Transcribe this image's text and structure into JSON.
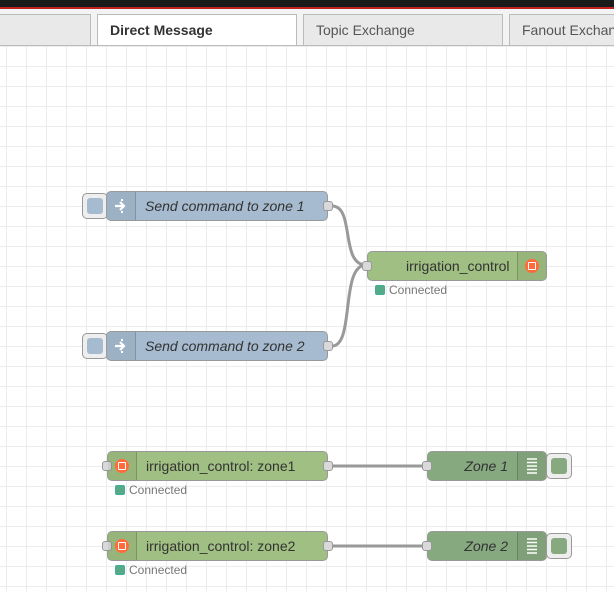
{
  "tabs": [
    {
      "label": ""
    },
    {
      "label": "Direct Message"
    },
    {
      "label": "Topic Exchange"
    },
    {
      "label": "Fanout Exchange"
    }
  ],
  "nodes": {
    "inject_zone1": {
      "label": "Send command to zone 1",
      "type": "inject",
      "icon": "arrow-in-icon"
    },
    "inject_zone2": {
      "label": "Send command to zone 2",
      "type": "inject",
      "icon": "arrow-in-icon"
    },
    "amqp_out": {
      "label": "irrigation_control",
      "status": "Connected",
      "icon": "amqp-icon"
    },
    "amqp_in_zone1": {
      "label": "irrigation_control: zone1",
      "status": "Connected",
      "icon": "amqp-icon"
    },
    "amqp_in_zone2": {
      "label": "irrigation_control: zone2",
      "status": "Connected",
      "icon": "amqp-icon"
    },
    "debug_zone1": {
      "label": "Zone 1",
      "icon": "debug-list-icon"
    },
    "debug_zone2": {
      "label": "Zone 2",
      "icon": "debug-list-icon"
    }
  },
  "colors": {
    "inject": "#a6bbcf",
    "amqp": "#a0bf82",
    "debug": "#87a980",
    "status_connected": "#55aa88",
    "header_accent": "#c02020"
  }
}
